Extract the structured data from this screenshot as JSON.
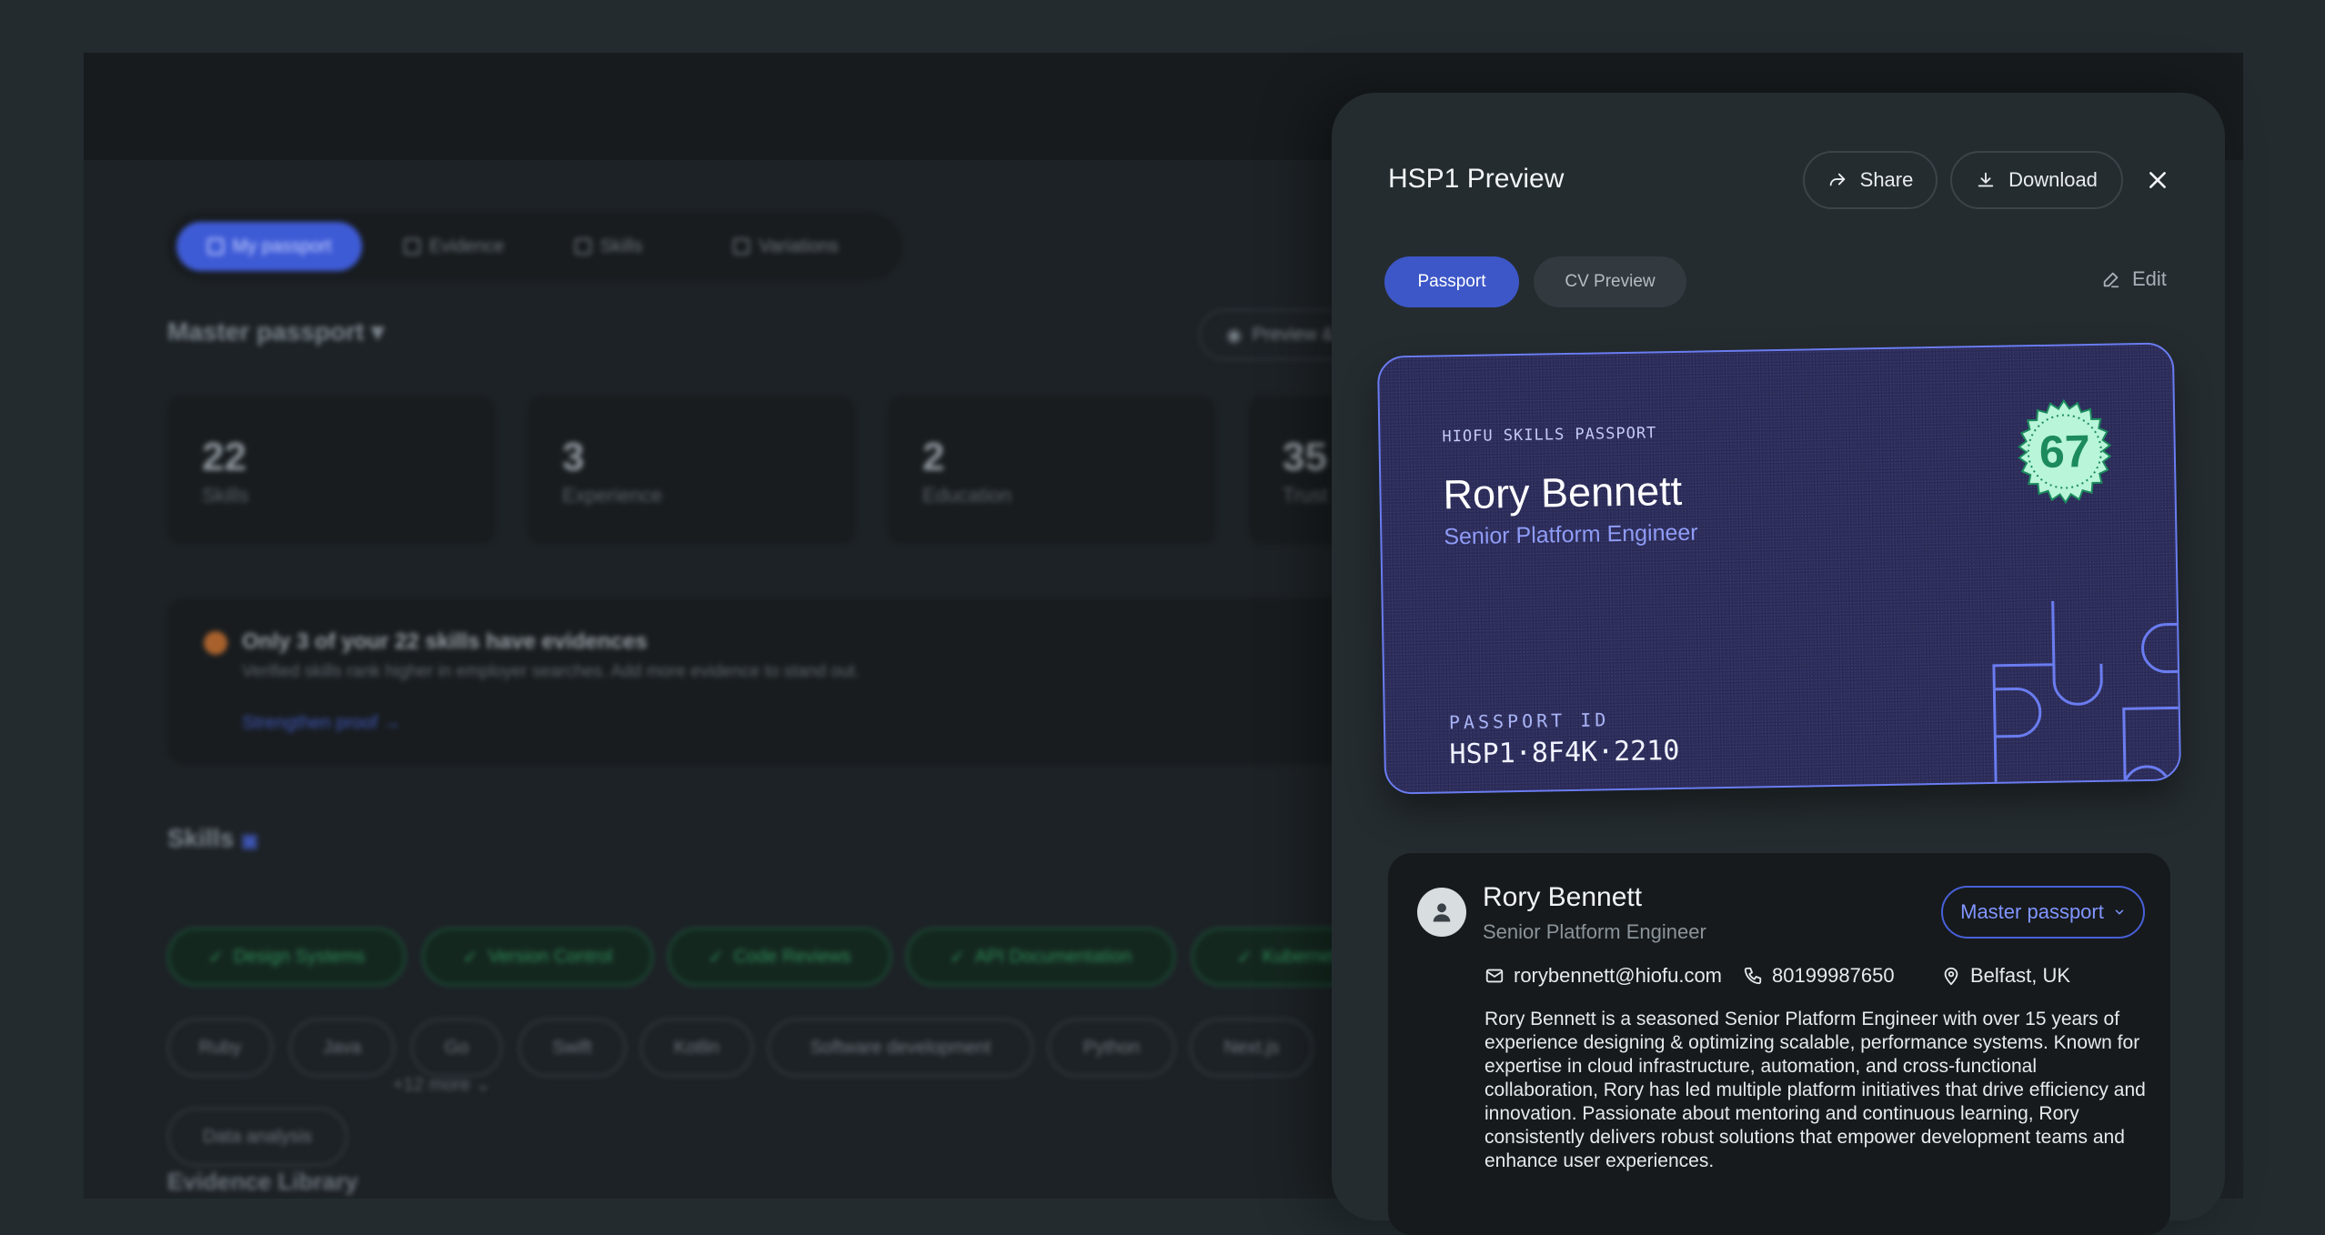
{
  "background": {
    "nav": {
      "tabs": [
        {
          "label": "My passport",
          "active": true
        },
        {
          "label": "Evidence",
          "active": false
        },
        {
          "label": "Skills",
          "active": false
        },
        {
          "label": "Variations",
          "active": false
        }
      ]
    },
    "passport_selector": "Master passport",
    "preview_button": "Preview &",
    "stats": [
      {
        "value": "22",
        "label": "Skills"
      },
      {
        "value": "3",
        "label": "Experience"
      },
      {
        "value": "2",
        "label": "Education"
      },
      {
        "value": "35",
        "label": "Trust"
      }
    ],
    "alert": {
      "title": "Only 3 of your 22 skills have evidences",
      "subtitle": "Verified skills rank higher in employer searches. Add more evidence to stand out.",
      "link": "Strengthen proof"
    },
    "skills_heading": "Skills",
    "verified_skills": [
      "Design Systems",
      "Version Control",
      "Code Reviews",
      "API Documentation",
      "Kubernetes"
    ],
    "other_skills": [
      "Ruby",
      "Java",
      "Go",
      "Swift",
      "Kotlin",
      "Software development",
      "Python",
      "Next.js"
    ],
    "extra_skills": [
      "Data analysis"
    ],
    "more_label": "+12 more",
    "evidence_heading": "Evidence Library"
  },
  "panel": {
    "title": "HSP1 Preview",
    "share_label": "Share",
    "download_label": "Download",
    "tabs": [
      {
        "label": "Passport",
        "active": true
      },
      {
        "label": "CV Preview",
        "active": false
      }
    ],
    "edit_label": "Edit",
    "card": {
      "label": "HIOFU SKILLS PASSPORT",
      "name": "Rory Bennett",
      "role": "Senior Platform Engineer",
      "score": "67",
      "passport_id_label": "PASSPORT ID",
      "passport_id": "HSP1·8F4K·2210"
    },
    "profile": {
      "name": "Rory Bennett",
      "role": "Senior Platform Engineer",
      "passport_select": "Master passport",
      "email": "rorybennett@hiofu.com",
      "phone": "80199987650",
      "location": "Belfast, UK",
      "bio": "Rory Bennett is a seasoned Senior Platform Engineer with over 15 years of experience designing & optimizing scalable, performance systems. Known for expertise in cloud infrastructure, automation, and cross-functional collaboration, Rory has led multiple platform initiatives that drive efficiency and innovation. Passionate about mentoring and continuous learning, Rory consistently delivers robust solutions that empower development teams and enhance user experiences."
    }
  },
  "colors": {
    "accent": "#3d57c8",
    "card_border": "#6a7cf0",
    "badge": "#b8f5d9",
    "verified_green": "#2f8a58"
  }
}
